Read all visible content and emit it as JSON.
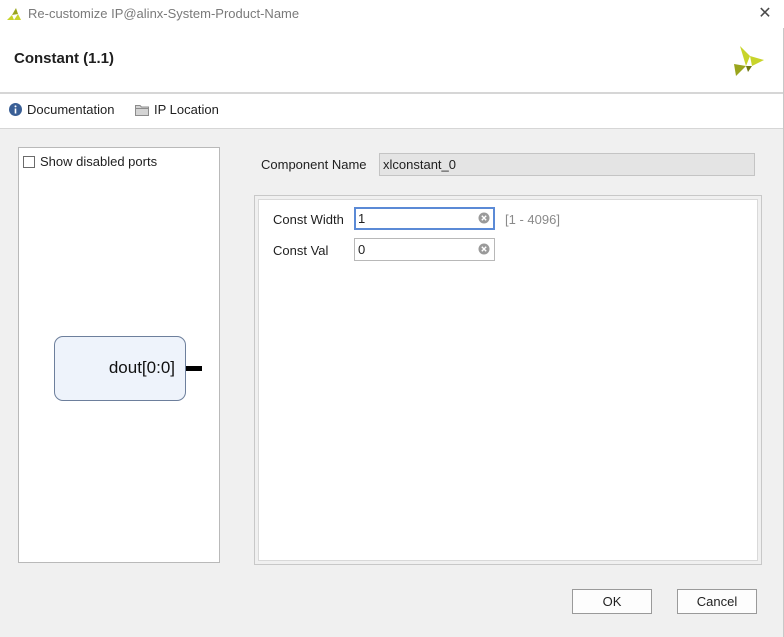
{
  "window": {
    "title": "Re-customize IP@alinx-System-Product-Name",
    "close_glyph": "✕"
  },
  "header": {
    "ip_title": "Constant (1.1)",
    "brand_color": "#c8d42a"
  },
  "toolbar": {
    "documentation_label": "Documentation",
    "ip_location_label": "IP Location",
    "icons": [
      "info-icon",
      "folder-icon"
    ]
  },
  "preview": {
    "show_disabled_ports_label": "Show disabled ports",
    "show_disabled_ports_checked": false,
    "port_label": "dout[0:0]"
  },
  "component": {
    "label": "Component Name",
    "value": "xlconstant_0"
  },
  "params": {
    "const_width": {
      "label": "Const Width",
      "value": "1",
      "range": "[1 - 4096]"
    },
    "const_val": {
      "label": "Const Val",
      "value": "0"
    }
  },
  "buttons": {
    "ok": "OK",
    "cancel": "Cancel"
  }
}
